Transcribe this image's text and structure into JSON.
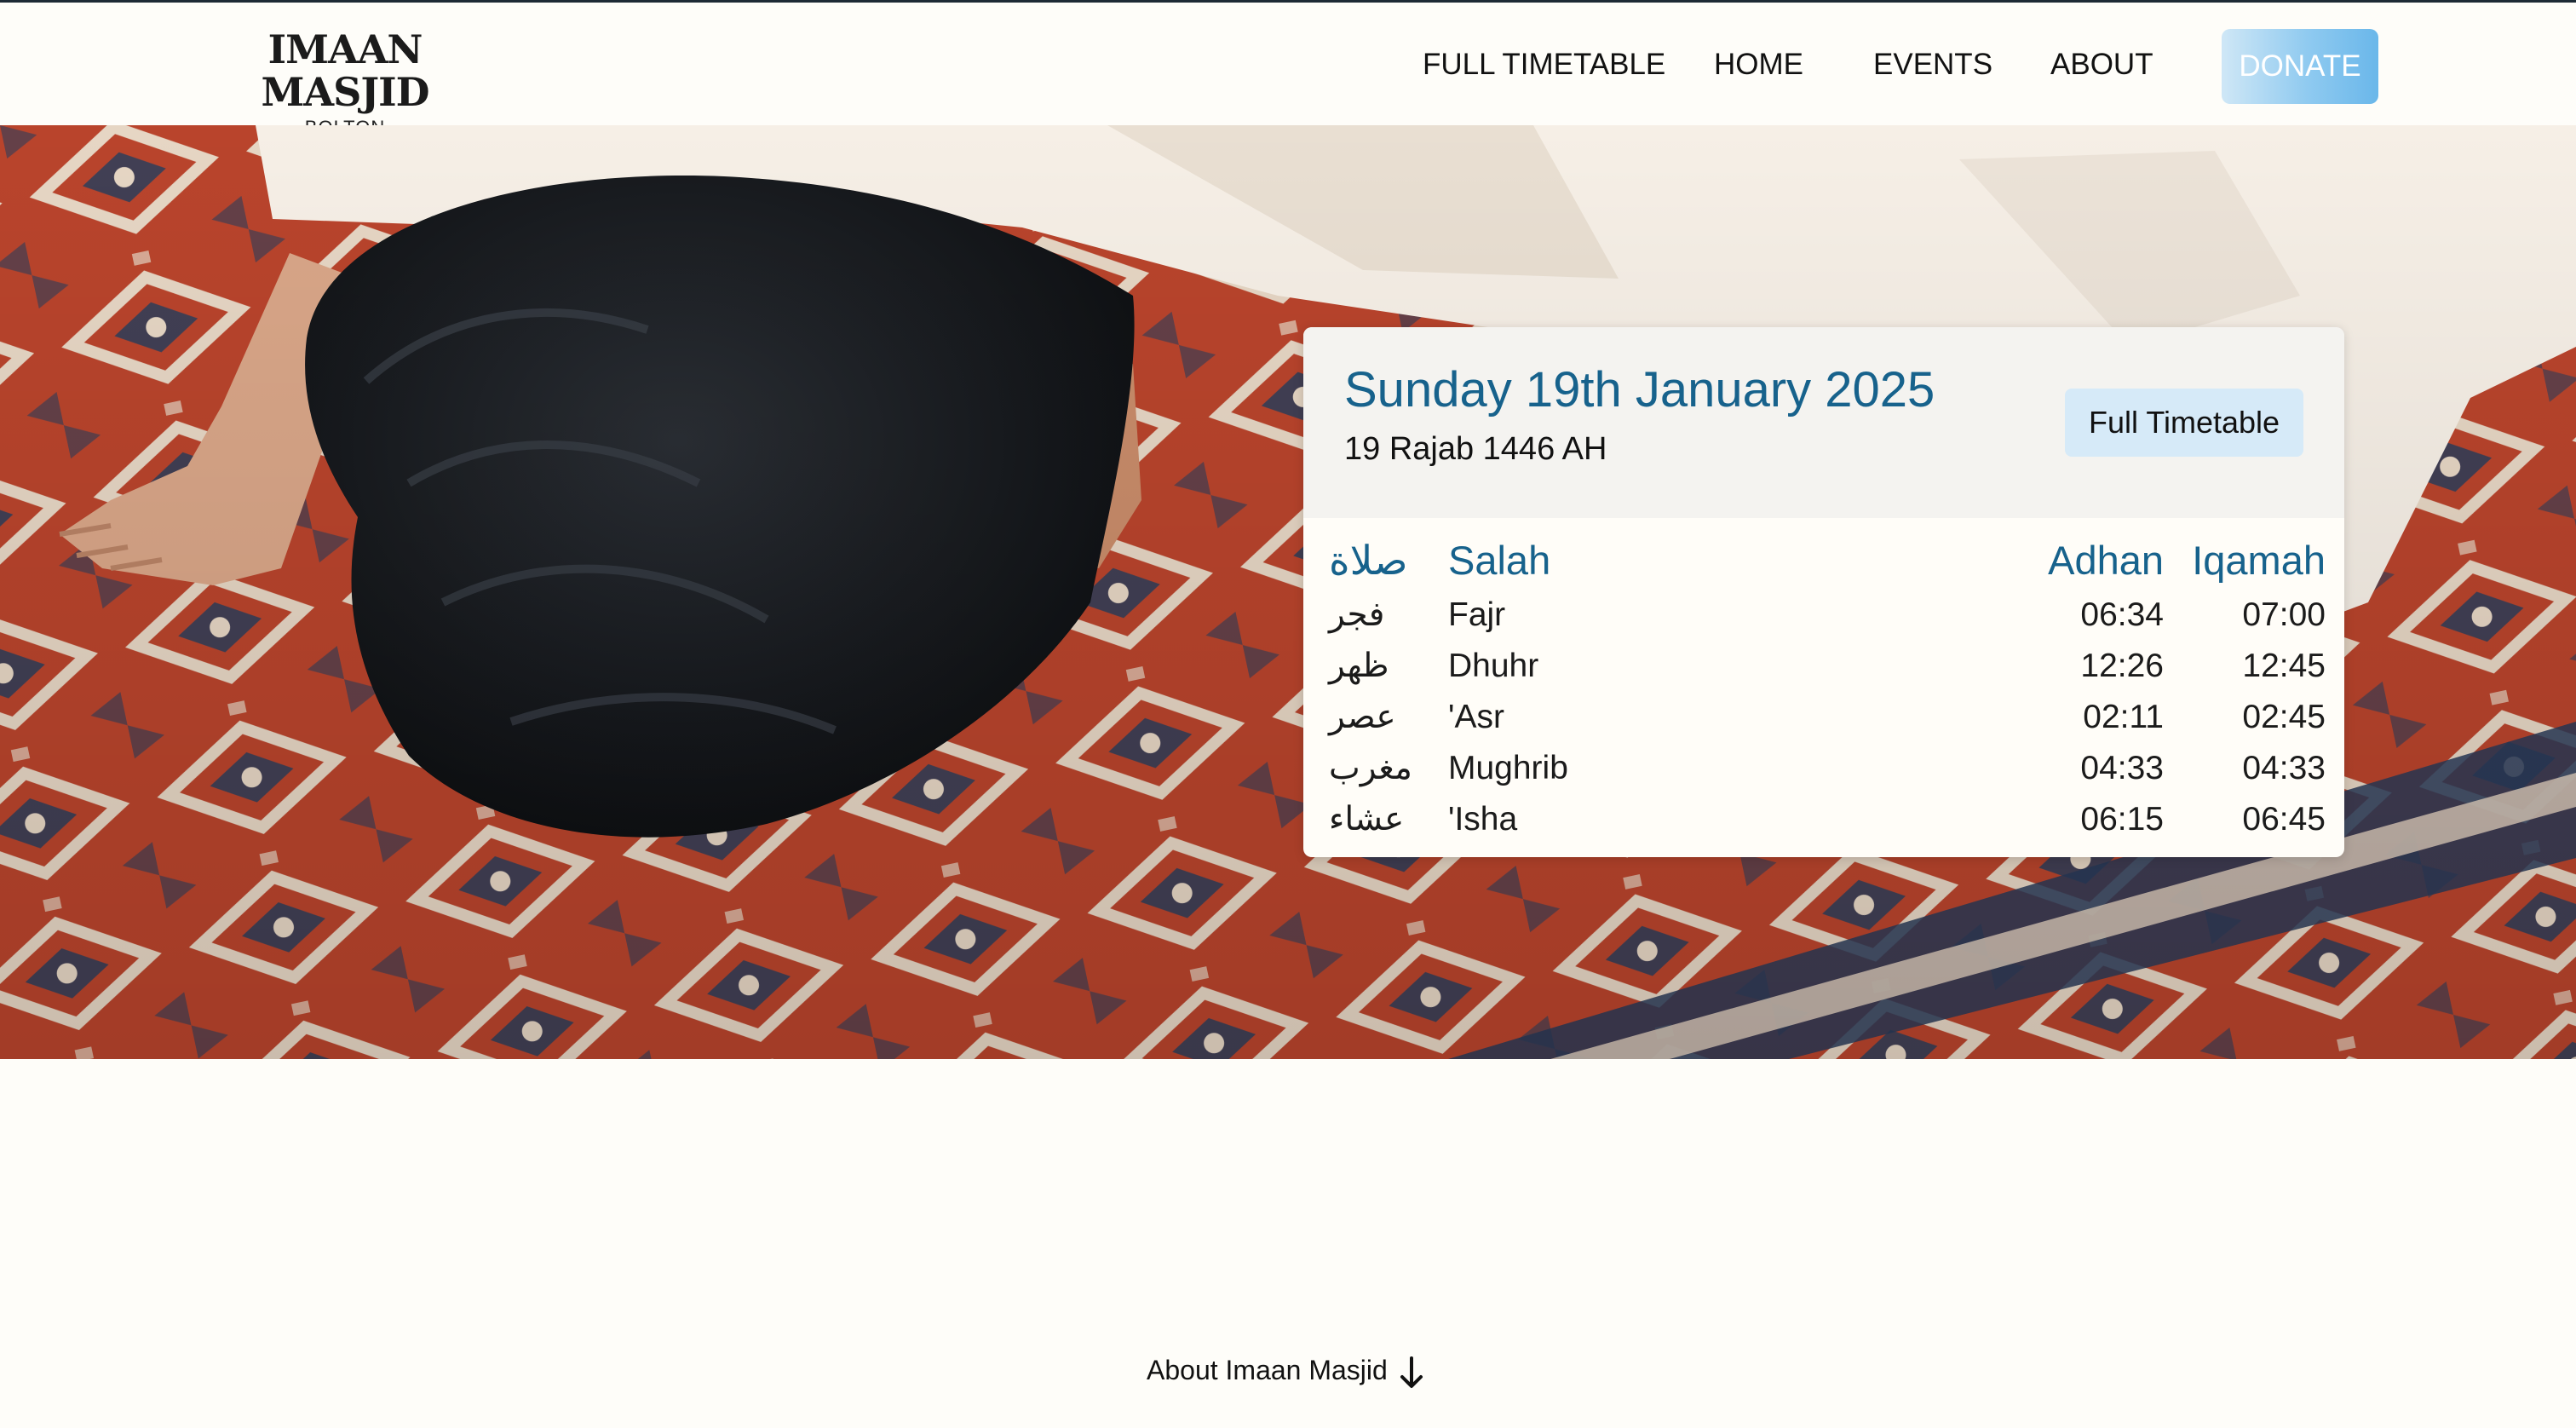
{
  "brand": {
    "name": "IMAAN MASJID",
    "location": "BOLTON"
  },
  "nav": {
    "items": [
      {
        "label": "FULL TIMETABLE"
      },
      {
        "label": "HOME"
      },
      {
        "label": "EVENTS"
      },
      {
        "label": "ABOUT"
      }
    ],
    "donate_label": "DONATE"
  },
  "hero": {
    "image": "person in sujood prostration on red patterned prayer rug"
  },
  "prayer_card": {
    "date": "Sunday 19th January 2025",
    "hijri_date": "19 Rajab 1446 AH",
    "button_label": "Full Timetable",
    "headers": {
      "arabic": "صلاة",
      "salah": "Salah",
      "adhan": "Adhan",
      "iqamah": "Iqamah"
    },
    "rows": [
      {
        "arabic": "فجر",
        "name": "Fajr",
        "adhan": "06:34",
        "iqamah": "07:00"
      },
      {
        "arabic": "ظهر",
        "name": "Dhuhr",
        "adhan": "12:26",
        "iqamah": "12:45"
      },
      {
        "arabic": "عصر",
        "name": "'Asr",
        "adhan": "02:11",
        "iqamah": "02:45"
      },
      {
        "arabic": "مغرب",
        "name": "Mughrib",
        "adhan": "04:33",
        "iqamah": "04:33"
      },
      {
        "arabic": "عشاء",
        "name": "'Isha",
        "adhan": "06:15",
        "iqamah": "06:45"
      }
    ]
  },
  "footer": {
    "about_link": "About Imaan Masjid",
    "arrow_icon": "arrow-down-icon"
  },
  "colors": {
    "accent": "#17628c",
    "donate": "#8fcaf0",
    "page_bg": "#fefdf9",
    "card_head_bg": "#f4f3f0"
  }
}
